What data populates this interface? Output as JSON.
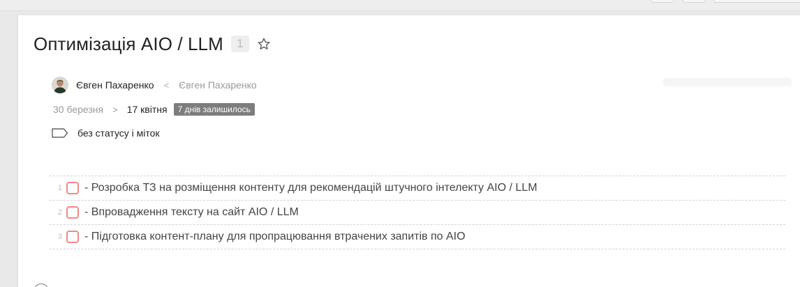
{
  "task": {
    "title": "Оптимізація AIO / LLM",
    "count": "1",
    "assignee": "Євген Пахаренко",
    "author_separator": "<",
    "author": "Євген Пахаренко",
    "date_start": "30 березня",
    "date_arrow": ">",
    "date_end": "17 квітня",
    "days_left": "7 днів залишилось",
    "status": "без статусу і міток"
  },
  "checklist": [
    {
      "num": "1",
      "text": "- Розробка ТЗ на розміщення контенту для рекомендацій штучного інтелекту AIO / LLM"
    },
    {
      "num": "2",
      "text": "- Впровадження тексту на сайт AIO / LLM"
    },
    {
      "num": "3",
      "text": "- Підготовка контент-плану для пропрацювання втрачених запитів по AIO"
    }
  ],
  "icons": {
    "favorite": "star-icon",
    "status": "tag-icon",
    "assignee": "avatar"
  },
  "colors": {
    "checkbox_border": "#ef8a8a",
    "days_left_badge": "#7d7d7d"
  }
}
